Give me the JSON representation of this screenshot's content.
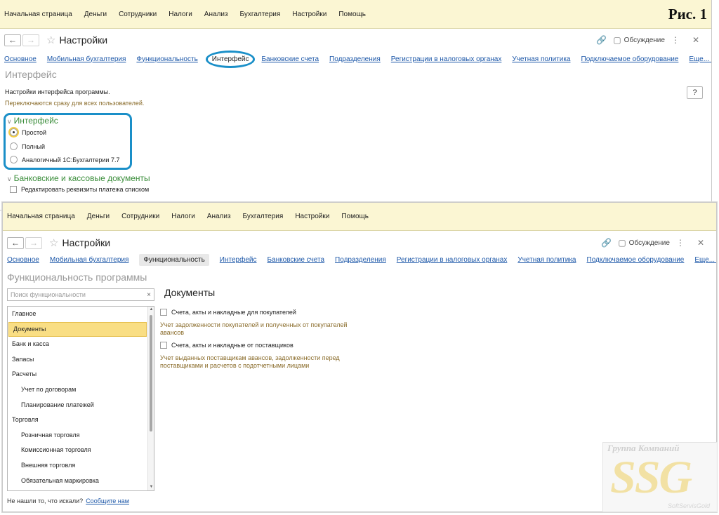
{
  "figure_label": "Рис. 1",
  "menu": [
    "Начальная страница",
    "Деньги",
    "Сотрудники",
    "Налоги",
    "Анализ",
    "Бухгалтерия",
    "Настройки",
    "Помощь"
  ],
  "window_title": "Настройки",
  "discussion_label": "Обсуждение",
  "tabs": [
    "Основное",
    "Мобильная бухгалтерия",
    "Функциональность",
    "Интерфейс",
    "Банковские счета",
    "Подразделения",
    "Регистрации в налоговых органах",
    "Учетная политика",
    "Подключаемое оборудование",
    "Еще..."
  ],
  "win1": {
    "section_title": "Интерфейс",
    "hint_line1": "Настройки интерфейса программы.",
    "hint_line2": "Переключаются сразу для всех пользователей.",
    "help_label": "?",
    "group1_title": "Интерфейс",
    "radio_options": [
      "Простой",
      "Полный",
      "Аналогичный 1С:Бухгалтерии 7.7"
    ],
    "selected_radio": "Простой",
    "group2_title": "Банковские и кассовые документы",
    "group2_checkbox": "Редактировать реквизиты платежа списком"
  },
  "win2": {
    "section_title": "Функциональность программы",
    "search_placeholder": "Поиск функциональности",
    "clear_icon": "×",
    "list_items": [
      {
        "label": "Главное",
        "level": 0
      },
      {
        "label": "Документы",
        "level": 0,
        "selected": true
      },
      {
        "label": "Банк и касса",
        "level": 0
      },
      {
        "label": "Запасы",
        "level": 0
      },
      {
        "label": "Расчеты",
        "level": 0
      },
      {
        "label": "Учет по договорам",
        "level": 1
      },
      {
        "label": "Планирование платежей",
        "level": 1
      },
      {
        "label": "Торговля",
        "level": 0
      },
      {
        "label": "Розничная торговля",
        "level": 1
      },
      {
        "label": "Комиссионная торговля",
        "level": 1
      },
      {
        "label": "Внешняя торговля",
        "level": 1
      },
      {
        "label": "Обязательная маркировка",
        "level": 1
      }
    ],
    "footer_text": "Не нашли то, что искали?",
    "footer_link": "Сообщите нам",
    "doc_title": "Документы",
    "option1_label": "Счета, акты и накладные для покупателей",
    "option1_desc_line1": "Учет задолженности покупателей и полученных от покупателей",
    "option1_desc_line2": "авансов",
    "option2_label": "Счета, акты и накладные от поставщиков",
    "option2_desc_line1": "Учет выданных поставщикам авансов, задолженности перед",
    "option2_desc_line2": "поставщиками и расчетов с подотчетными лицами"
  },
  "watermark": {
    "top": "Группа Компаний",
    "main": "SSG",
    "sub": "SoftServisGold"
  },
  "colors": {
    "menu_bg": "#fbf6d3",
    "link": "#1c57a8",
    "group_title": "#3a8d3a",
    "highlight_ring": "#1a8fc8",
    "selected_row": "#f9de84",
    "hint_text": "#8a6c2b"
  }
}
